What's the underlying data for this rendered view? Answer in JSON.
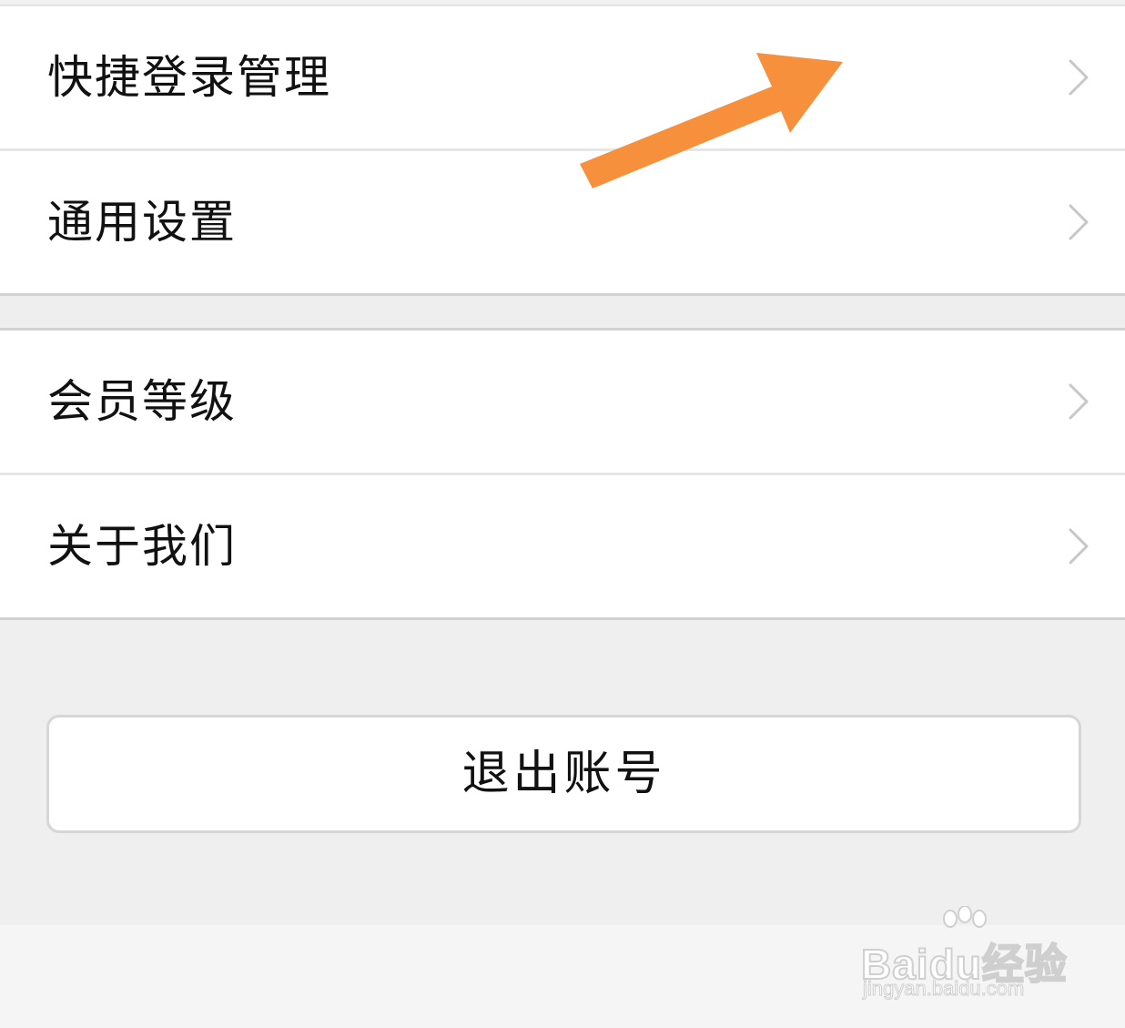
{
  "settings": {
    "group1": [
      {
        "label": "快捷登录管理"
      },
      {
        "label": "通用设置"
      }
    ],
    "group2": [
      {
        "label": "会员等级"
      },
      {
        "label": "关于我们"
      }
    ],
    "chevron_icon": "chevron-right-icon"
  },
  "logout": {
    "label": "退出账号"
  },
  "annotation": {
    "icon": "arrow-icon",
    "color": "#f7903d"
  },
  "watermark": {
    "brand_a": "Bai",
    "brand_b": "du",
    "brand_c": "经验",
    "url": "jingyan.baidu.com"
  },
  "colors": {
    "background": "#efefef",
    "row_background": "#ffffff",
    "text": "#111111",
    "chevron": "#c7c7c7",
    "divider": "#e6e6e6"
  }
}
